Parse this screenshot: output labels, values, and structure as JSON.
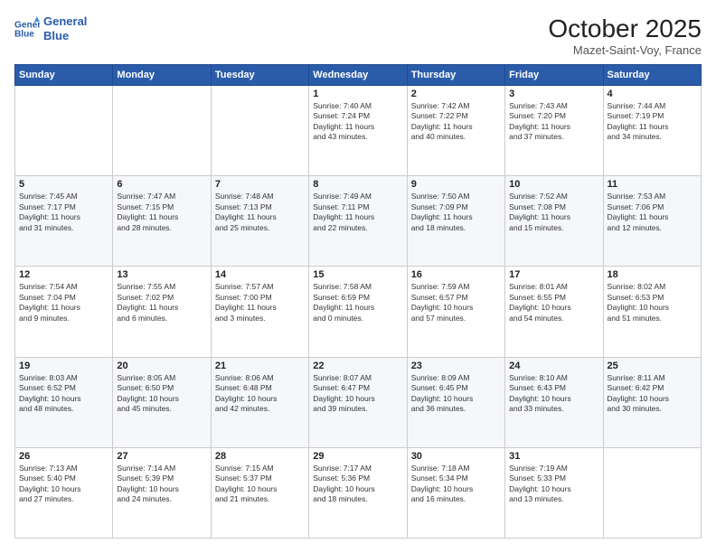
{
  "header": {
    "logo_line1": "General",
    "logo_line2": "Blue",
    "month_title": "October 2025",
    "location": "Mazet-Saint-Voy, France"
  },
  "weekdays": [
    "Sunday",
    "Monday",
    "Tuesday",
    "Wednesday",
    "Thursday",
    "Friday",
    "Saturday"
  ],
  "weeks": [
    [
      {
        "day": "",
        "detail": ""
      },
      {
        "day": "",
        "detail": ""
      },
      {
        "day": "",
        "detail": ""
      },
      {
        "day": "1",
        "detail": "Sunrise: 7:40 AM\nSunset: 7:24 PM\nDaylight: 11 hours\nand 43 minutes."
      },
      {
        "day": "2",
        "detail": "Sunrise: 7:42 AM\nSunset: 7:22 PM\nDaylight: 11 hours\nand 40 minutes."
      },
      {
        "day": "3",
        "detail": "Sunrise: 7:43 AM\nSunset: 7:20 PM\nDaylight: 11 hours\nand 37 minutes."
      },
      {
        "day": "4",
        "detail": "Sunrise: 7:44 AM\nSunset: 7:19 PM\nDaylight: 11 hours\nand 34 minutes."
      }
    ],
    [
      {
        "day": "5",
        "detail": "Sunrise: 7:45 AM\nSunset: 7:17 PM\nDaylight: 11 hours\nand 31 minutes."
      },
      {
        "day": "6",
        "detail": "Sunrise: 7:47 AM\nSunset: 7:15 PM\nDaylight: 11 hours\nand 28 minutes."
      },
      {
        "day": "7",
        "detail": "Sunrise: 7:48 AM\nSunset: 7:13 PM\nDaylight: 11 hours\nand 25 minutes."
      },
      {
        "day": "8",
        "detail": "Sunrise: 7:49 AM\nSunset: 7:11 PM\nDaylight: 11 hours\nand 22 minutes."
      },
      {
        "day": "9",
        "detail": "Sunrise: 7:50 AM\nSunset: 7:09 PM\nDaylight: 11 hours\nand 18 minutes."
      },
      {
        "day": "10",
        "detail": "Sunrise: 7:52 AM\nSunset: 7:08 PM\nDaylight: 11 hours\nand 15 minutes."
      },
      {
        "day": "11",
        "detail": "Sunrise: 7:53 AM\nSunset: 7:06 PM\nDaylight: 11 hours\nand 12 minutes."
      }
    ],
    [
      {
        "day": "12",
        "detail": "Sunrise: 7:54 AM\nSunset: 7:04 PM\nDaylight: 11 hours\nand 9 minutes."
      },
      {
        "day": "13",
        "detail": "Sunrise: 7:55 AM\nSunset: 7:02 PM\nDaylight: 11 hours\nand 6 minutes."
      },
      {
        "day": "14",
        "detail": "Sunrise: 7:57 AM\nSunset: 7:00 PM\nDaylight: 11 hours\nand 3 minutes."
      },
      {
        "day": "15",
        "detail": "Sunrise: 7:58 AM\nSunset: 6:59 PM\nDaylight: 11 hours\nand 0 minutes."
      },
      {
        "day": "16",
        "detail": "Sunrise: 7:59 AM\nSunset: 6:57 PM\nDaylight: 10 hours\nand 57 minutes."
      },
      {
        "day": "17",
        "detail": "Sunrise: 8:01 AM\nSunset: 6:55 PM\nDaylight: 10 hours\nand 54 minutes."
      },
      {
        "day": "18",
        "detail": "Sunrise: 8:02 AM\nSunset: 6:53 PM\nDaylight: 10 hours\nand 51 minutes."
      }
    ],
    [
      {
        "day": "19",
        "detail": "Sunrise: 8:03 AM\nSunset: 6:52 PM\nDaylight: 10 hours\nand 48 minutes."
      },
      {
        "day": "20",
        "detail": "Sunrise: 8:05 AM\nSunset: 6:50 PM\nDaylight: 10 hours\nand 45 minutes."
      },
      {
        "day": "21",
        "detail": "Sunrise: 8:06 AM\nSunset: 6:48 PM\nDaylight: 10 hours\nand 42 minutes."
      },
      {
        "day": "22",
        "detail": "Sunrise: 8:07 AM\nSunset: 6:47 PM\nDaylight: 10 hours\nand 39 minutes."
      },
      {
        "day": "23",
        "detail": "Sunrise: 8:09 AM\nSunset: 6:45 PM\nDaylight: 10 hours\nand 36 minutes."
      },
      {
        "day": "24",
        "detail": "Sunrise: 8:10 AM\nSunset: 6:43 PM\nDaylight: 10 hours\nand 33 minutes."
      },
      {
        "day": "25",
        "detail": "Sunrise: 8:11 AM\nSunset: 6:42 PM\nDaylight: 10 hours\nand 30 minutes."
      }
    ],
    [
      {
        "day": "26",
        "detail": "Sunrise: 7:13 AM\nSunset: 5:40 PM\nDaylight: 10 hours\nand 27 minutes."
      },
      {
        "day": "27",
        "detail": "Sunrise: 7:14 AM\nSunset: 5:39 PM\nDaylight: 10 hours\nand 24 minutes."
      },
      {
        "day": "28",
        "detail": "Sunrise: 7:15 AM\nSunset: 5:37 PM\nDaylight: 10 hours\nand 21 minutes."
      },
      {
        "day": "29",
        "detail": "Sunrise: 7:17 AM\nSunset: 5:36 PM\nDaylight: 10 hours\nand 18 minutes."
      },
      {
        "day": "30",
        "detail": "Sunrise: 7:18 AM\nSunset: 5:34 PM\nDaylight: 10 hours\nand 16 minutes."
      },
      {
        "day": "31",
        "detail": "Sunrise: 7:19 AM\nSunset: 5:33 PM\nDaylight: 10 hours\nand 13 minutes."
      },
      {
        "day": "",
        "detail": ""
      }
    ]
  ]
}
